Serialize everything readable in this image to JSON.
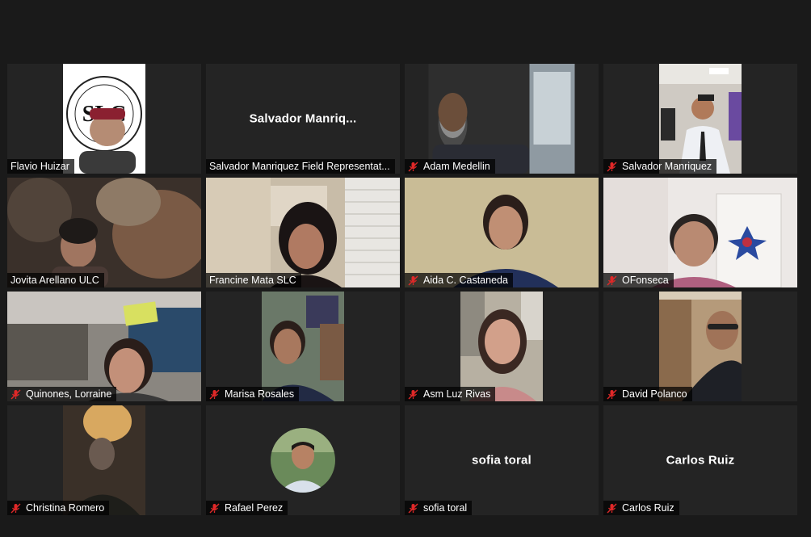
{
  "meeting": {
    "participants": [
      {
        "name": "Flavio Huizar",
        "muted": false,
        "center_label": "",
        "logo_text": "SACRAMENTO LOWRIDER COMMISSION",
        "logo_initials": "SLC"
      },
      {
        "name": "Salvador Manriquez Field Representat...",
        "muted": false,
        "center_label": "Salvador  Manriq..."
      },
      {
        "name": "Adam Medellin",
        "muted": true,
        "center_label": ""
      },
      {
        "name": "Salvador Manriquez",
        "muted": true,
        "center_label": ""
      },
      {
        "name": "Jovita Arellano ULC",
        "muted": false,
        "center_label": "",
        "active_speaker": true
      },
      {
        "name": "Francine Mata SLC",
        "muted": false,
        "center_label": ""
      },
      {
        "name": "Aida C. Castaneda",
        "muted": true,
        "center_label": ""
      },
      {
        "name": "OFonseca",
        "muted": true,
        "center_label": ""
      },
      {
        "name": "Quinones, Lorraine",
        "muted": true,
        "center_label": ""
      },
      {
        "name": "Marisa Rosales",
        "muted": true,
        "center_label": ""
      },
      {
        "name": "Asm Luz Rivas",
        "muted": true,
        "center_label": ""
      },
      {
        "name": "David Polanco",
        "muted": true,
        "center_label": ""
      },
      {
        "name": "Christina Romero",
        "muted": true,
        "center_label": ""
      },
      {
        "name": "Rafael Perez",
        "muted": true,
        "center_label": ""
      },
      {
        "name": "sofia toral",
        "muted": true,
        "center_label": "sofia toral"
      },
      {
        "name": "Carlos Ruiz",
        "muted": true,
        "center_label": "Carlos Ruiz"
      }
    ]
  },
  "colors": {
    "background": "#1a1a1a",
    "tile": "#242424",
    "active_border": "#d5df6a",
    "mute_red": "#e02828"
  },
  "icons": {
    "mute": "microphone-muted-icon"
  }
}
